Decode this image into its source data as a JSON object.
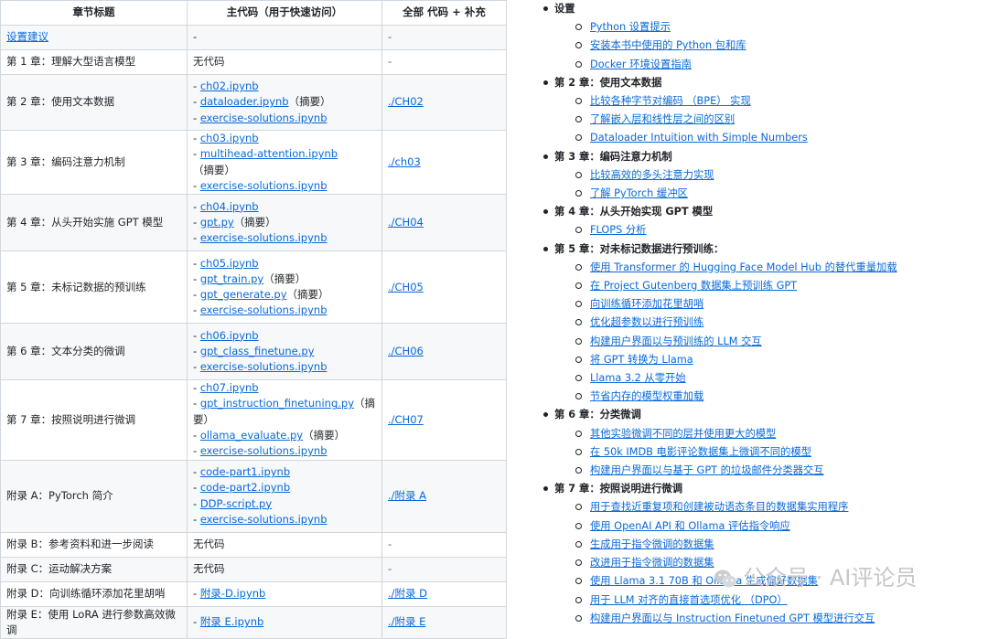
{
  "table": {
    "headers": [
      "章节标题",
      "主代码（用于快速访问）",
      "全部 代码 + 补充"
    ],
    "rows": [
      {
        "title": "设置建议",
        "title_link": true,
        "main": [
          {
            "prefix": "",
            "text": "-",
            "link": false,
            "suffix": ""
          }
        ],
        "all": "-",
        "all_link": false
      },
      {
        "title": "第 1 章：理解大型语言模型",
        "title_link": false,
        "main": [
          {
            "prefix": "",
            "text": "无代码",
            "link": false,
            "suffix": ""
          }
        ],
        "all": "-",
        "all_link": false
      },
      {
        "title": "第 2 章：使用文本数据",
        "title_link": false,
        "main": [
          {
            "prefix": "- ",
            "text": "ch02.ipynb",
            "link": true,
            "suffix": ""
          },
          {
            "prefix": "- ",
            "text": "dataloader.ipynb",
            "link": true,
            "suffix": "（摘要）"
          },
          {
            "prefix": "- ",
            "text": "exercise-solutions.ipynb",
            "link": true,
            "suffix": ""
          }
        ],
        "all": "./CH02",
        "all_link": true
      },
      {
        "title": "第 3 章：编码注意力机制",
        "title_link": false,
        "main": [
          {
            "prefix": "- ",
            "text": "ch03.ipynb",
            "link": true,
            "suffix": ""
          },
          {
            "prefix": "- ",
            "text": "multihead-attention.ipynb",
            "link": true,
            "suffix": "（摘要）"
          },
          {
            "prefix": "- ",
            "text": "exercise-solutions.ipynb",
            "link": true,
            "suffix": ""
          }
        ],
        "all": "./ch03",
        "all_link": true
      },
      {
        "title": "第 4 章：从头开始实施 GPT 模型",
        "title_link": false,
        "main": [
          {
            "prefix": "- ",
            "text": "ch04.ipynb",
            "link": true,
            "suffix": ""
          },
          {
            "prefix": "- ",
            "text": "gpt.py",
            "link": true,
            "suffix": "（摘要）"
          },
          {
            "prefix": "- ",
            "text": "exercise-solutions.ipynb",
            "link": true,
            "suffix": ""
          }
        ],
        "all": "./CH04",
        "all_link": true
      },
      {
        "title": "第 5 章：未标记数据的预训练",
        "title_link": false,
        "main": [
          {
            "prefix": "- ",
            "text": "ch05.ipynb",
            "link": true,
            "suffix": ""
          },
          {
            "prefix": "- ",
            "text": "gpt_train.py",
            "link": true,
            "suffix": "（摘要）"
          },
          {
            "prefix": "- ",
            "text": "gpt_generate.py",
            "link": true,
            "suffix": "（摘要）"
          },
          {
            "prefix": "- ",
            "text": "exercise-solutions.ipynb",
            "link": true,
            "suffix": ""
          }
        ],
        "all": "./CH05",
        "all_link": true
      },
      {
        "title": "第 6 章：文本分类的微调",
        "title_link": false,
        "main": [
          {
            "prefix": "- ",
            "text": "ch06.ipynb",
            "link": true,
            "suffix": ""
          },
          {
            "prefix": "- ",
            "text": "gpt_class_finetune.py",
            "link": true,
            "suffix": ""
          },
          {
            "prefix": "- ",
            "text": "exercise-solutions.ipynb",
            "link": true,
            "suffix": ""
          }
        ],
        "all": "./CH06",
        "all_link": true
      },
      {
        "title": "第 7 章：按照说明进行微调",
        "title_link": false,
        "main": [
          {
            "prefix": "- ",
            "text": "ch07.ipynb",
            "link": true,
            "suffix": ""
          },
          {
            "prefix": "- ",
            "text": "gpt_instruction_finetuning.py",
            "link": true,
            "suffix": "（摘要）"
          },
          {
            "prefix": "- ",
            "text": "ollama_evaluate.py",
            "link": true,
            "suffix": "（摘要）"
          },
          {
            "prefix": "- ",
            "text": "exercise-solutions.ipynb",
            "link": true,
            "suffix": ""
          }
        ],
        "all": "./CH07",
        "all_link": true
      },
      {
        "title": "附录 A：PyTorch 简介",
        "title_link": false,
        "main": [
          {
            "prefix": "- ",
            "text": "code-part1.ipynb",
            "link": true,
            "suffix": ""
          },
          {
            "prefix": "- ",
            "text": "code-part2.ipynb",
            "link": true,
            "suffix": ""
          },
          {
            "prefix": "- ",
            "text": "DDP-script.py",
            "link": true,
            "suffix": ""
          },
          {
            "prefix": "- ",
            "text": "exercise-solutions.ipynb",
            "link": true,
            "suffix": ""
          }
        ],
        "all": "./附录 A",
        "all_link": true
      },
      {
        "title": "附录 B：参考资料和进一步阅读",
        "title_link": false,
        "main": [
          {
            "prefix": "",
            "text": "无代码",
            "link": false,
            "suffix": ""
          }
        ],
        "all": "-",
        "all_link": false
      },
      {
        "title": "附录 C：运动解决方案",
        "title_link": false,
        "main": [
          {
            "prefix": "",
            "text": "无代码",
            "link": false,
            "suffix": ""
          }
        ],
        "all": "-",
        "all_link": false
      },
      {
        "title": "附录 D：向训练循环添加花里胡哨",
        "title_link": false,
        "main": [
          {
            "prefix": "- ",
            "text": "附录-D.ipynb",
            "link": true,
            "suffix": ""
          }
        ],
        "all": "./附录 D",
        "all_link": true
      },
      {
        "title": "附录 E：使用 LoRA 进行参数高效微调",
        "title_link": false,
        "main": [
          {
            "prefix": "- ",
            "text": "附录 E.ipynb",
            "link": true,
            "suffix": ""
          }
        ],
        "all": "./附录 E",
        "all_link": true
      }
    ]
  },
  "outline": [
    {
      "section": "设置",
      "items": [
        "Python 设置提示",
        "安装本书中使用的 Python 包和库",
        "Docker 环境设置指南"
      ]
    },
    {
      "section": "第 2 章：使用文本数据",
      "items": [
        "比较各种字节对编码 （BPE） 实现",
        "了解嵌入层和线性层之间的区别",
        "Dataloader Intuition with Simple Numbers"
      ]
    },
    {
      "section": "第 3 章：编码注意力机制",
      "items": [
        "比较高效的多头注意力实现",
        "了解 PyTorch 缓冲区"
      ]
    },
    {
      "section": "第 4 章：从头开始实现 GPT 模型",
      "items": [
        "FLOPS 分析"
      ]
    },
    {
      "section": "第 5 章：对未标记数据进行预训练：",
      "items": [
        "使用 Transformer 的 Hugging Face Model Hub 的替代重量加载",
        "在 Project Gutenberg 数据集上预训练 GPT",
        "向训练循环添加花里胡哨",
        "优化超参数以进行预训练",
        "构建用户界面以与预训练的 LLM 交互",
        "将 GPT 转换为 Llama",
        "Llama 3.2 从零开始",
        "节省内存的模型权重加载"
      ]
    },
    {
      "section": "第 6 章：分类微调",
      "items": [
        "其他实验微调不同的层并使用更大的模型",
        "在 50k IMDB 电影评论数据集上微调不同的模型",
        "构建用户界面以与基于 GPT 的垃圾邮件分类器交互"
      ]
    },
    {
      "section": "第 7 章：按照说明进行微调",
      "items": [
        "用于查找近重复项和创建被动语态条目的数据集实用程序",
        "使用 OpenAI API 和 Ollama 评估指令响应",
        "生成用于指令微调的数据集",
        "改进用于指令微调的数据集",
        "使用 Llama 3.1 70B 和 Ollama 生成偏好数据集",
        "用于 LLM 对齐的直接首选项优化 （DPO）",
        "构建用户界面以与 Instruction Finetuned GPT 模型进行交互"
      ]
    }
  ],
  "watermark": "公众号 · AI评论员",
  "colors": {
    "link": "#0969da",
    "border": "#d0d7de",
    "stripe": "#f6f8fa"
  }
}
